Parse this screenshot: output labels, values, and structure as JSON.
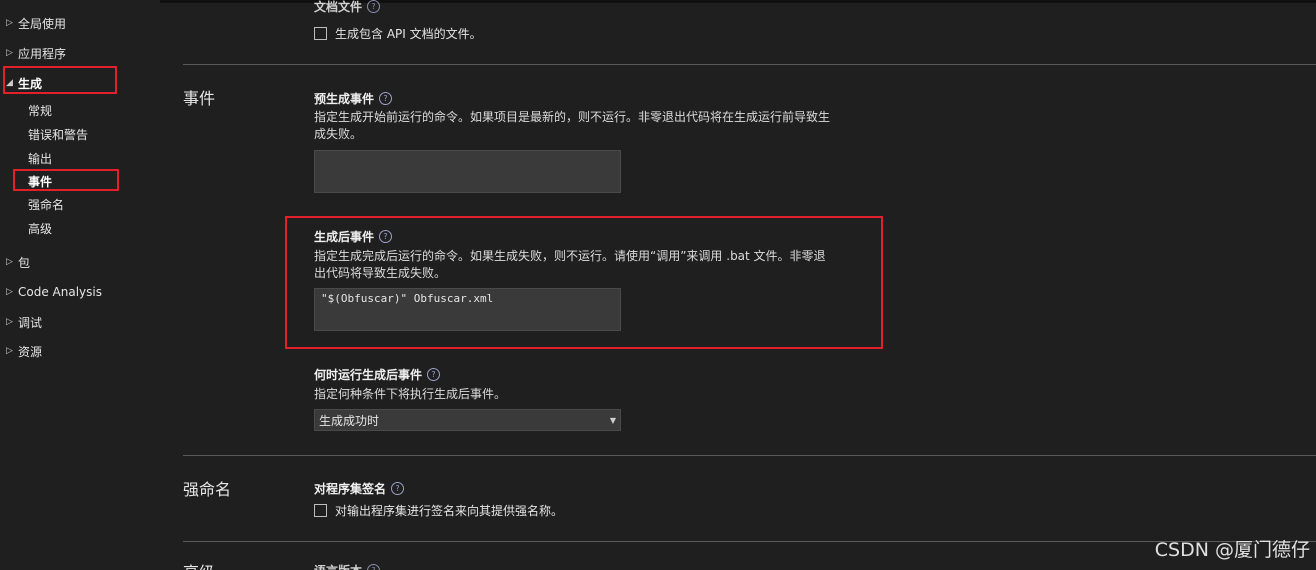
{
  "sidebar": {
    "items": [
      {
        "label": "全局使用",
        "arrow": "▷"
      },
      {
        "label": "应用程序",
        "arrow": "▷"
      },
      {
        "label": "生成",
        "arrow": "◢"
      },
      {
        "label": "包",
        "arrow": "▷"
      },
      {
        "label": "Code Analysis",
        "arrow": "▷"
      },
      {
        "label": "调试",
        "arrow": "▷"
      },
      {
        "label": "资源",
        "arrow": "▷"
      }
    ],
    "build_children": [
      "常规",
      "错误和警告",
      "输出",
      "事件",
      "强命名",
      "高级"
    ]
  },
  "doc_section": {
    "partial_label": "文档文件",
    "checkbox_label": "生成包含 API 文档的文件。"
  },
  "events_section": {
    "title": "事件",
    "pre_build": {
      "label": "预生成事件",
      "desc": "指定生成开始前运行的命令。如果项目是最新的，则不运行。非零退出代码将在生成运行前导致生成失败。",
      "value": ""
    },
    "post_build": {
      "label": "生成后事件",
      "desc": "指定生成完成后运行的命令。如果生成失败，则不运行。请使用“调用”来调用 .bat 文件。非零退出代码将导致生成失败。",
      "value": "\"$(Obfuscar)\" Obfuscar.xml"
    },
    "run_when": {
      "label": "何时运行生成后事件",
      "desc": "指定何种条件下将执行生成后事件。",
      "selected": "生成成功时"
    }
  },
  "strong_name_section": {
    "title": "强命名",
    "sign": {
      "label": "对程序集签名",
      "checkbox_label": "对输出程序集进行签名来向其提供强名称。"
    }
  },
  "advanced_section": {
    "title": "高级",
    "partial_label": "语言版本"
  },
  "watermark": "CSDN @厦门德仔",
  "colors": {
    "background": "#1f1f1f",
    "highlight_box": "#e0202a",
    "input_bg": "#3a3a3a",
    "separator": "#5a5a5a"
  }
}
